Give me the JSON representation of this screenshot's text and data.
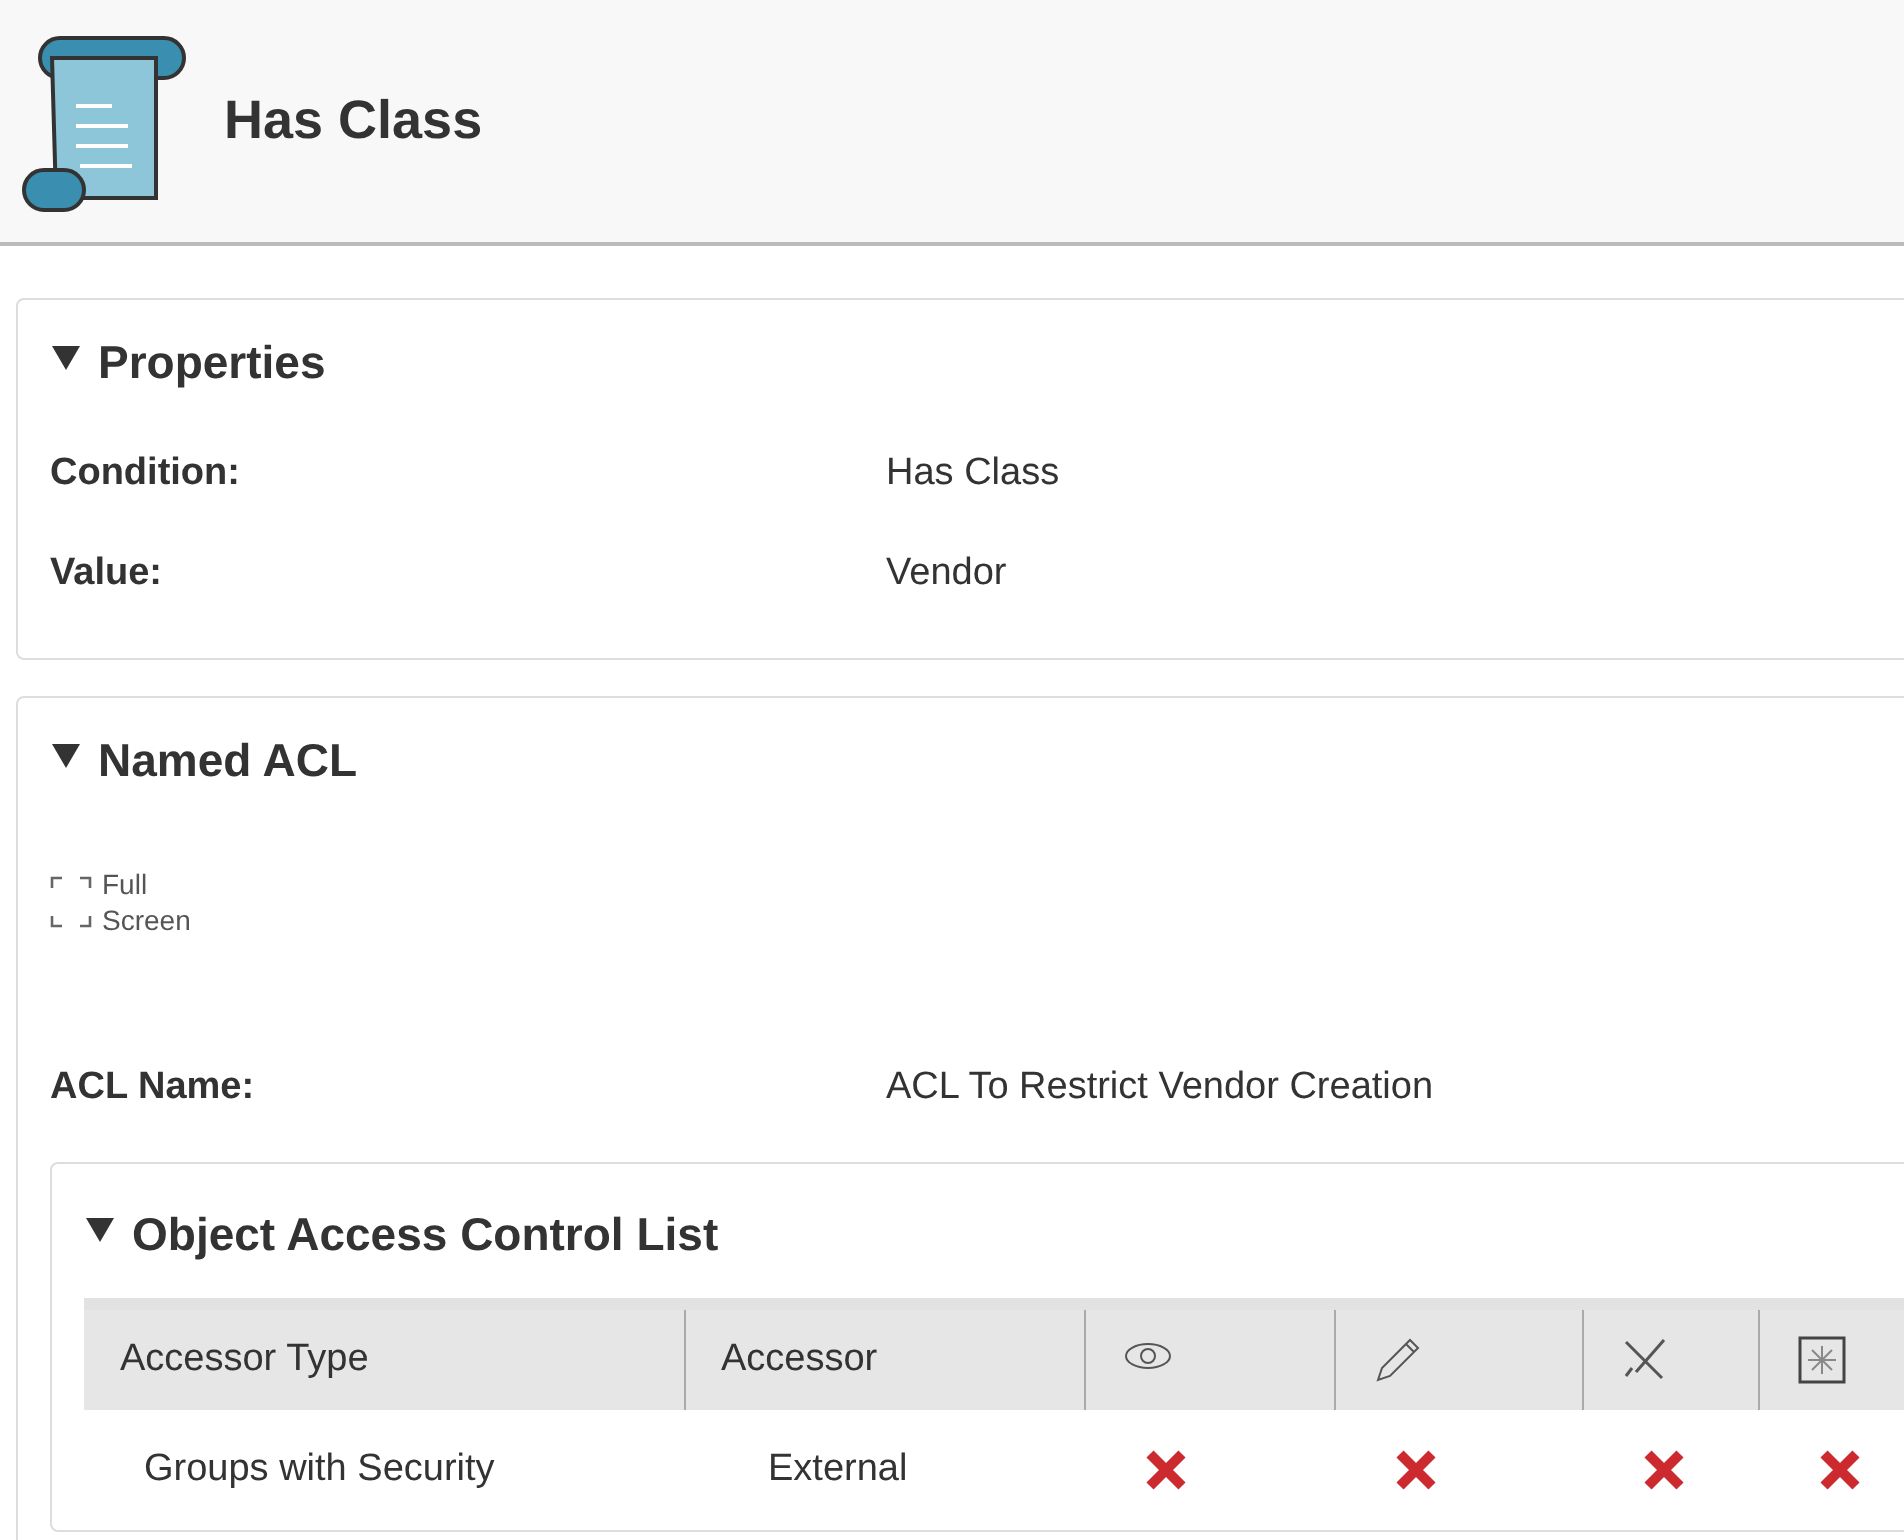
{
  "header": {
    "title": "Has Class"
  },
  "properties": {
    "title": "Properties",
    "expanded": true,
    "fields": [
      {
        "label": "Condition:",
        "value": "Has Class"
      },
      {
        "label": "Value:",
        "value": "Vendor"
      }
    ]
  },
  "named_acl": {
    "title": "Named ACL",
    "expanded": true,
    "full_screen_link": "Full Screen",
    "acl_name_label": "ACL Name:",
    "acl_name": "ACL To Restrict Vendor Creation",
    "object_acl": {
      "title": "Object Access Control List",
      "expanded": true,
      "columns": [
        {
          "kind": "text",
          "label": "Accessor Type"
        },
        {
          "kind": "text",
          "label": "Accessor"
        },
        {
          "kind": "read"
        },
        {
          "kind": "write"
        },
        {
          "kind": "delete"
        },
        {
          "kind": "admin"
        }
      ],
      "rows": [
        {
          "accessor_type": "Groups with Security",
          "accessor": "External",
          "permissions": [
            {
              "allowed": false
            },
            {
              "allowed": false
            },
            {
              "allowed": false
            },
            {
              "allowed": false
            }
          ]
        }
      ]
    }
  }
}
